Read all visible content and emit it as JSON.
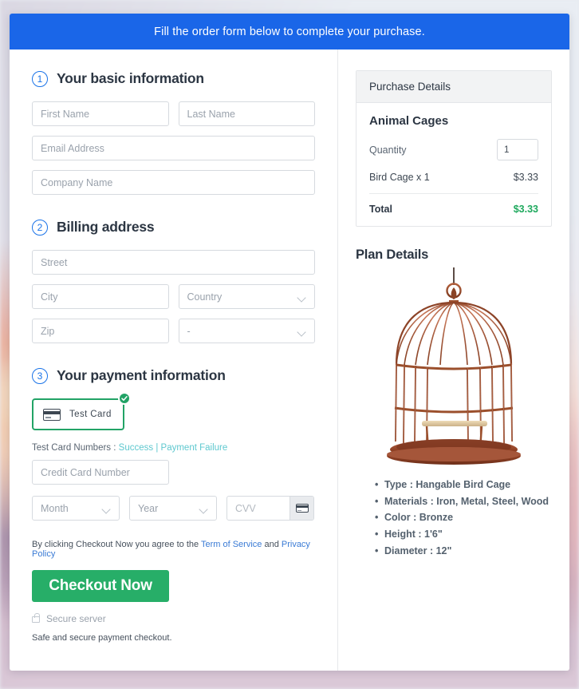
{
  "banner": {
    "text": "Fill the order form below to complete your purchase."
  },
  "steps": [
    {
      "num": "1",
      "title": "Your basic information"
    },
    {
      "num": "2",
      "title": "Billing address"
    },
    {
      "num": "3",
      "title": "Your payment information"
    }
  ],
  "basic_info": {
    "first_name_placeholder": "First Name",
    "last_name_placeholder": "Last Name",
    "email_placeholder": "Email Address",
    "company_placeholder": "Company Name"
  },
  "billing": {
    "street_placeholder": "Street",
    "city_placeholder": "City",
    "country_placeholder": "Country",
    "zip_placeholder": "Zip",
    "state_placeholder": "-"
  },
  "payment": {
    "method_label": "Test Card",
    "method_selected": true,
    "test_prefix": "Test Card Numbers :",
    "test_success": "Success",
    "test_separator": "|",
    "test_failure": "Payment Failure",
    "card_number_placeholder": "Credit Card Number",
    "month_placeholder": "Month",
    "year_placeholder": "Year",
    "cvv_placeholder": "CVV"
  },
  "terms": {
    "prefix": "By clicking Checkout Now you agree to the",
    "tos": "Term of Service",
    "and": "and",
    "privacy": "Privacy Policy"
  },
  "checkout": {
    "button_label": "Checkout Now",
    "secure_label": "Secure server",
    "safe_note": "Safe and secure payment checkout."
  },
  "purchase": {
    "header": "Purchase Details",
    "product": "Animal Cages",
    "quantity_label": "Quantity",
    "quantity_value": "1",
    "line_item_label": "Bird Cage x 1",
    "line_item_price": "$3.33",
    "total_label": "Total",
    "total_price": "$3.33"
  },
  "plan": {
    "title": "Plan Details",
    "image_alt": "bronze-hanging-bird-cage",
    "specs": [
      "Type : Hangable Bird Cage",
      "Materials : Iron, Metal, Steel, Wood",
      "Color : Bronze",
      "Height : 1'6\"",
      "Diameter : 12\""
    ]
  },
  "colors": {
    "banner_blue": "#1a66e8",
    "accent_blue": "#1a73e8",
    "success_green": "#27ae68",
    "total_green": "#1fa95e",
    "link_teal": "#5ec8cf",
    "link_blue": "#3a7bd5",
    "cage_bronze": "#a0522d"
  }
}
